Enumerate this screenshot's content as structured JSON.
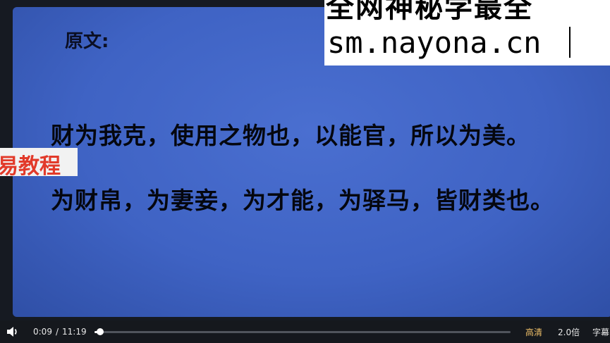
{
  "slide": {
    "heading": "原文:",
    "line1": "财为我克，使用之物也，以能官，所以为美。",
    "line2": "为财帛，为妻妾，为才能，为驿马，皆财类也。"
  },
  "watermark": {
    "top_text": "全网神秘学最全",
    "url": "sm.nayona.cn"
  },
  "left_badge": {
    "text": "易教程"
  },
  "player": {
    "current_time": "0:09",
    "separator": "/",
    "duration": "11:19",
    "progress_fraction": 0.0133,
    "quality": "高清",
    "speed": "2.0倍",
    "subtitles": "字幕",
    "volume_icon": "speaker-icon"
  },
  "colors": {
    "slide_blue": "#3f63c4",
    "quality_accent": "#f0c069",
    "badge_text": "#e23a2a"
  }
}
